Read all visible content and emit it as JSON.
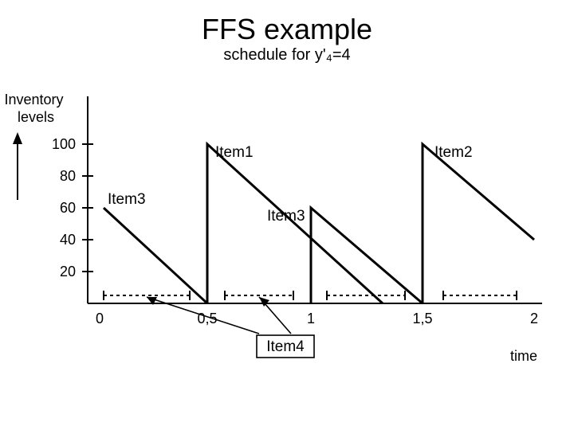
{
  "title": "FFS example",
  "subtitle": "schedule for y'₄=4",
  "y_axis_label": "Inventory levels",
  "x_axis_label": "time",
  "y_ticks": [
    "20",
    "40",
    "60",
    "80",
    "100"
  ],
  "x_ticks": [
    "0",
    "0,5",
    "1",
    "1,5",
    "2"
  ],
  "labels": {
    "item1": "Item1",
    "item2": "Item2",
    "item3a": "Item3",
    "item3b": "Item3",
    "item4": "Item4"
  },
  "chart_data": {
    "type": "line",
    "title": "FFS example — Inventory levels over time",
    "xlabel": "time",
    "ylabel": "Inventory levels",
    "xlim": [
      0,
      2
    ],
    "ylim": [
      0,
      100
    ],
    "x_ticks": [
      0,
      0.5,
      1,
      1.5,
      2
    ],
    "y_ticks": [
      20,
      40,
      60,
      80,
      100
    ],
    "series": [
      {
        "name": "Item3 (first)",
        "points": [
          [
            0,
            60
          ],
          [
            0.5,
            0
          ]
        ]
      },
      {
        "name": "Item1",
        "points": [
          [
            0.5,
            0
          ],
          [
            0.5,
            100
          ],
          [
            1.33,
            0
          ]
        ]
      },
      {
        "name": "Item3 (second)",
        "points": [
          [
            1,
            0
          ],
          [
            1,
            60
          ],
          [
            1.5,
            0
          ]
        ]
      },
      {
        "name": "Item2",
        "points": [
          [
            1.5,
            0
          ],
          [
            1.5,
            100
          ],
          [
            2,
            40
          ]
        ]
      }
    ],
    "item4_intervals": [
      [
        0,
        0.5
      ],
      [
        0.5,
        1
      ],
      [
        1,
        1.5
      ],
      [
        1.5,
        2
      ]
    ],
    "annotations": [
      {
        "text": "Item3",
        "at": [
          0.05,
          60
        ]
      },
      {
        "text": "Item1",
        "at": [
          0.55,
          100
        ]
      },
      {
        "text": "Item3",
        "at": [
          0.8,
          55
        ]
      },
      {
        "text": "Item2",
        "at": [
          1.55,
          100
        ]
      },
      {
        "text": "Item4",
        "at": [
          0.95,
          -25
        ],
        "boxed": true
      }
    ]
  }
}
